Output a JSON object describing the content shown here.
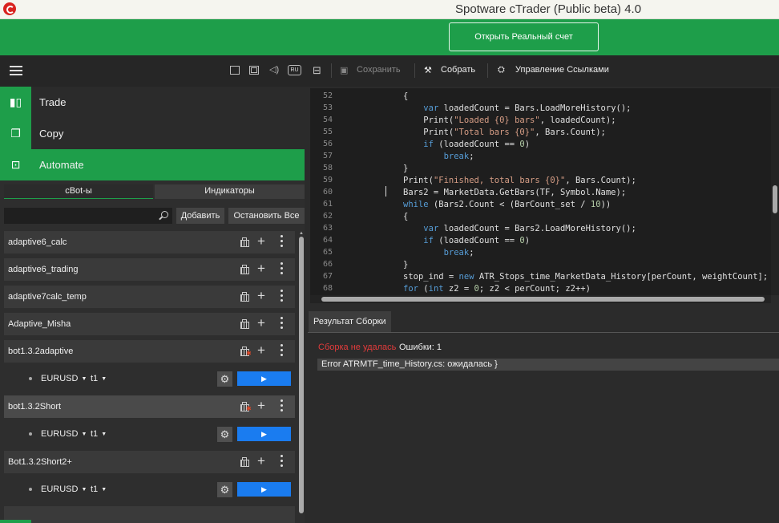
{
  "window": {
    "title": "Spotware cTrader (Public beta) 4.0"
  },
  "header": {
    "open_account_label": "Открыть Реальный счет"
  },
  "topbar": {
    "language_badge": "RU"
  },
  "nav": {
    "items": [
      {
        "label": "Trade",
        "icon": "trade-candles-icon"
      },
      {
        "label": "Copy",
        "icon": "copy-icon"
      },
      {
        "label": "Automate",
        "icon": "robot-icon"
      }
    ]
  },
  "subtabs": {
    "cbots": "cBot-ы",
    "indicators": "Индикаторы"
  },
  "search": {
    "placeholder": "",
    "add_label": "Добавить",
    "stop_all_label": "Остановить Все"
  },
  "bots": [
    {
      "name": "adaptive6_calc"
    },
    {
      "name": "adaptive6_trading"
    },
    {
      "name": "adaptive7calc_temp"
    },
    {
      "name": "Adaptive_Misha"
    },
    {
      "name": "bot1.3.2adaptive",
      "warning": true,
      "instance": {
        "symbol": "EURUSD",
        "timeframe": "t1"
      }
    },
    {
      "name": "bot1.3.2Short",
      "warning": true,
      "selected": true,
      "instance": {
        "symbol": "EURUSD",
        "timeframe": "t1"
      }
    },
    {
      "name": "Bot1.3.2Short2+",
      "instance": {
        "symbol": "EURUSD",
        "timeframe": "t1"
      }
    }
  ],
  "editor_toolbar": {
    "save_label": "Сохранить",
    "build_label": "Собрать",
    "references_label": "Управление Ссылками"
  },
  "code": {
    "lines": [
      {
        "n": "52",
        "text": "{"
      },
      {
        "n": "53",
        "text": "    var loadedCount = Bars.LoadMoreHistory();"
      },
      {
        "n": "54",
        "text": "    Print(\"Loaded {0} bars\", loadedCount);"
      },
      {
        "n": "55",
        "text": "    Print(\"Total bars {0}\", Bars.Count);"
      },
      {
        "n": "56",
        "text": "    if (loadedCount == 0)"
      },
      {
        "n": "57",
        "text": "        break;"
      },
      {
        "n": "58",
        "text": "}"
      },
      {
        "n": "59",
        "text": "Print(\"Finished, total bars {0}\", Bars.Count);"
      },
      {
        "n": "60",
        "text": "Bars2 = MarketData.GetBars(TF, Symbol.Name);"
      },
      {
        "n": "61",
        "text": "while (Bars2.Count < (BarCount_set / 10))"
      },
      {
        "n": "62",
        "text": "{"
      },
      {
        "n": "63",
        "text": "    var loadedCount = Bars2.LoadMoreHistory();"
      },
      {
        "n": "64",
        "text": "    if (loadedCount == 0)"
      },
      {
        "n": "65",
        "text": "        break;"
      },
      {
        "n": "66",
        "text": "}"
      },
      {
        "n": "67",
        "text": "stop_ind = new ATR_Stops_time_MarketData_History[perCount, weightCount];"
      },
      {
        "n": "68",
        "text": "for (int z2 = 0; z2 < perCount; z2++)"
      }
    ]
  },
  "build_panel": {
    "tab_label": "Результат Сборки",
    "status_fail": "Сборка не удалась",
    "errors_label": "Ошибки: 1",
    "error_message": "Error ATRMTF_time_History.cs: ожидалась }"
  },
  "colors": {
    "brand_green": "#1e9e4a",
    "play_blue": "#1a7cf0",
    "error_red": "#e23b3b"
  }
}
